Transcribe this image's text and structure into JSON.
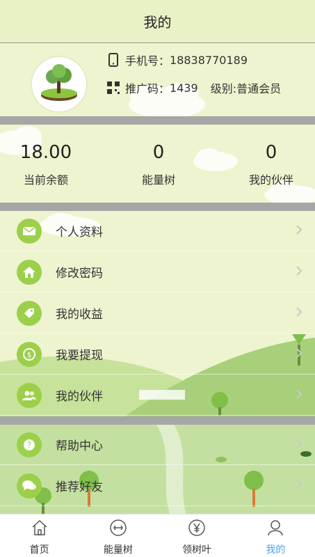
{
  "header": {
    "title": "我的"
  },
  "profile": {
    "phone_label": "手机号：",
    "phone": "18838770189",
    "promo_label": "推广码：",
    "promo_code": "1439",
    "level_label": "级别:",
    "level": "普通会员"
  },
  "stats": [
    {
      "value": "18.00",
      "label": "当前余额"
    },
    {
      "value": "0",
      "label": "能量树"
    },
    {
      "value": "0",
      "label": "我的伙伴"
    }
  ],
  "menu": [
    {
      "label": "个人资料",
      "icon": "mail-icon"
    },
    {
      "label": "修改密码",
      "icon": "home-icon"
    },
    {
      "label": "我的收益",
      "icon": "tag-icon"
    },
    {
      "label": "我要提现",
      "icon": "coin-icon"
    },
    {
      "label": "我的伙伴",
      "icon": "users-icon"
    },
    {
      "label": "帮助中心",
      "icon": "question-icon"
    },
    {
      "label": "推荐好友",
      "icon": "chat-icon"
    }
  ],
  "tabs": [
    {
      "label": "首页",
      "icon": "home-outline-icon"
    },
    {
      "label": "能量树",
      "icon": "energy-icon"
    },
    {
      "label": "领树叶",
      "icon": "yen-icon"
    },
    {
      "label": "我的",
      "icon": "person-icon"
    }
  ],
  "colors": {
    "accent": "#4ca3e8",
    "icon_green": "#9ccf4a",
    "separator": "#a6a6a6",
    "background": "#eef4cf"
  }
}
